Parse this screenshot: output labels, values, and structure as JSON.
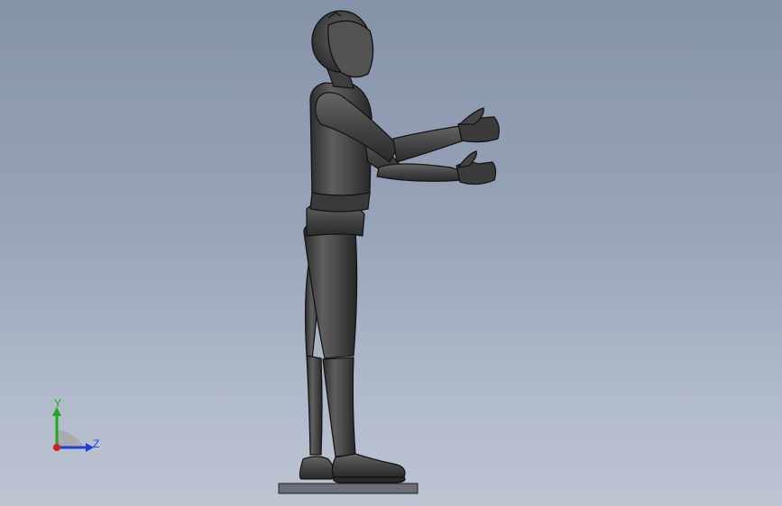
{
  "viewport": {
    "background_top": "#8593a9",
    "background_bottom": "#bdc5d3"
  },
  "model": {
    "body_color": "#4a4a4a",
    "edge_color": "#111111",
    "highlight_color": "#7a7a7a",
    "ground_plate_color": "#6b6e78"
  },
  "triad": {
    "y_label": "Y",
    "z_label": "Z",
    "y_color": "#1fa81f",
    "z_color": "#1f3fd8",
    "x_color": "#d81f1f"
  }
}
